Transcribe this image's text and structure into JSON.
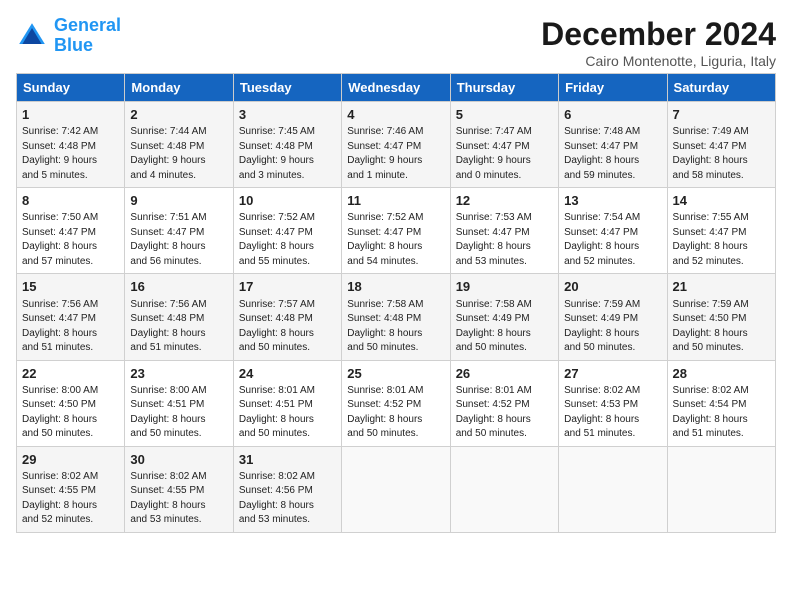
{
  "header": {
    "logo_line1": "General",
    "logo_line2": "Blue",
    "title": "December 2024",
    "subtitle": "Cairo Montenotte, Liguria, Italy"
  },
  "columns": [
    "Sunday",
    "Monday",
    "Tuesday",
    "Wednesday",
    "Thursday",
    "Friday",
    "Saturday"
  ],
  "weeks": [
    [
      {
        "day": "1",
        "lines": [
          "Sunrise: 7:42 AM",
          "Sunset: 4:48 PM",
          "Daylight: 9 hours",
          "and 5 minutes."
        ]
      },
      {
        "day": "2",
        "lines": [
          "Sunrise: 7:44 AM",
          "Sunset: 4:48 PM",
          "Daylight: 9 hours",
          "and 4 minutes."
        ]
      },
      {
        "day": "3",
        "lines": [
          "Sunrise: 7:45 AM",
          "Sunset: 4:48 PM",
          "Daylight: 9 hours",
          "and 3 minutes."
        ]
      },
      {
        "day": "4",
        "lines": [
          "Sunrise: 7:46 AM",
          "Sunset: 4:47 PM",
          "Daylight: 9 hours",
          "and 1 minute."
        ]
      },
      {
        "day": "5",
        "lines": [
          "Sunrise: 7:47 AM",
          "Sunset: 4:47 PM",
          "Daylight: 9 hours",
          "and 0 minutes."
        ]
      },
      {
        "day": "6",
        "lines": [
          "Sunrise: 7:48 AM",
          "Sunset: 4:47 PM",
          "Daylight: 8 hours",
          "and 59 minutes."
        ]
      },
      {
        "day": "7",
        "lines": [
          "Sunrise: 7:49 AM",
          "Sunset: 4:47 PM",
          "Daylight: 8 hours",
          "and 58 minutes."
        ]
      }
    ],
    [
      {
        "day": "8",
        "lines": [
          "Sunrise: 7:50 AM",
          "Sunset: 4:47 PM",
          "Daylight: 8 hours",
          "and 57 minutes."
        ]
      },
      {
        "day": "9",
        "lines": [
          "Sunrise: 7:51 AM",
          "Sunset: 4:47 PM",
          "Daylight: 8 hours",
          "and 56 minutes."
        ]
      },
      {
        "day": "10",
        "lines": [
          "Sunrise: 7:52 AM",
          "Sunset: 4:47 PM",
          "Daylight: 8 hours",
          "and 55 minutes."
        ]
      },
      {
        "day": "11",
        "lines": [
          "Sunrise: 7:52 AM",
          "Sunset: 4:47 PM",
          "Daylight: 8 hours",
          "and 54 minutes."
        ]
      },
      {
        "day": "12",
        "lines": [
          "Sunrise: 7:53 AM",
          "Sunset: 4:47 PM",
          "Daylight: 8 hours",
          "and 53 minutes."
        ]
      },
      {
        "day": "13",
        "lines": [
          "Sunrise: 7:54 AM",
          "Sunset: 4:47 PM",
          "Daylight: 8 hours",
          "and 52 minutes."
        ]
      },
      {
        "day": "14",
        "lines": [
          "Sunrise: 7:55 AM",
          "Sunset: 4:47 PM",
          "Daylight: 8 hours",
          "and 52 minutes."
        ]
      }
    ],
    [
      {
        "day": "15",
        "lines": [
          "Sunrise: 7:56 AM",
          "Sunset: 4:47 PM",
          "Daylight: 8 hours",
          "and 51 minutes."
        ]
      },
      {
        "day": "16",
        "lines": [
          "Sunrise: 7:56 AM",
          "Sunset: 4:48 PM",
          "Daylight: 8 hours",
          "and 51 minutes."
        ]
      },
      {
        "day": "17",
        "lines": [
          "Sunrise: 7:57 AM",
          "Sunset: 4:48 PM",
          "Daylight: 8 hours",
          "and 50 minutes."
        ]
      },
      {
        "day": "18",
        "lines": [
          "Sunrise: 7:58 AM",
          "Sunset: 4:48 PM",
          "Daylight: 8 hours",
          "and 50 minutes."
        ]
      },
      {
        "day": "19",
        "lines": [
          "Sunrise: 7:58 AM",
          "Sunset: 4:49 PM",
          "Daylight: 8 hours",
          "and 50 minutes."
        ]
      },
      {
        "day": "20",
        "lines": [
          "Sunrise: 7:59 AM",
          "Sunset: 4:49 PM",
          "Daylight: 8 hours",
          "and 50 minutes."
        ]
      },
      {
        "day": "21",
        "lines": [
          "Sunrise: 7:59 AM",
          "Sunset: 4:50 PM",
          "Daylight: 8 hours",
          "and 50 minutes."
        ]
      }
    ],
    [
      {
        "day": "22",
        "lines": [
          "Sunrise: 8:00 AM",
          "Sunset: 4:50 PM",
          "Daylight: 8 hours",
          "and 50 minutes."
        ]
      },
      {
        "day": "23",
        "lines": [
          "Sunrise: 8:00 AM",
          "Sunset: 4:51 PM",
          "Daylight: 8 hours",
          "and 50 minutes."
        ]
      },
      {
        "day": "24",
        "lines": [
          "Sunrise: 8:01 AM",
          "Sunset: 4:51 PM",
          "Daylight: 8 hours",
          "and 50 minutes."
        ]
      },
      {
        "day": "25",
        "lines": [
          "Sunrise: 8:01 AM",
          "Sunset: 4:52 PM",
          "Daylight: 8 hours",
          "and 50 minutes."
        ]
      },
      {
        "day": "26",
        "lines": [
          "Sunrise: 8:01 AM",
          "Sunset: 4:52 PM",
          "Daylight: 8 hours",
          "and 50 minutes."
        ]
      },
      {
        "day": "27",
        "lines": [
          "Sunrise: 8:02 AM",
          "Sunset: 4:53 PM",
          "Daylight: 8 hours",
          "and 51 minutes."
        ]
      },
      {
        "day": "28",
        "lines": [
          "Sunrise: 8:02 AM",
          "Sunset: 4:54 PM",
          "Daylight: 8 hours",
          "and 51 minutes."
        ]
      }
    ],
    [
      {
        "day": "29",
        "lines": [
          "Sunrise: 8:02 AM",
          "Sunset: 4:55 PM",
          "Daylight: 8 hours",
          "and 52 minutes."
        ]
      },
      {
        "day": "30",
        "lines": [
          "Sunrise: 8:02 AM",
          "Sunset: 4:55 PM",
          "Daylight: 8 hours",
          "and 53 minutes."
        ]
      },
      {
        "day": "31",
        "lines": [
          "Sunrise: 8:02 AM",
          "Sunset: 4:56 PM",
          "Daylight: 8 hours",
          "and 53 minutes."
        ]
      },
      null,
      null,
      null,
      null
    ]
  ]
}
